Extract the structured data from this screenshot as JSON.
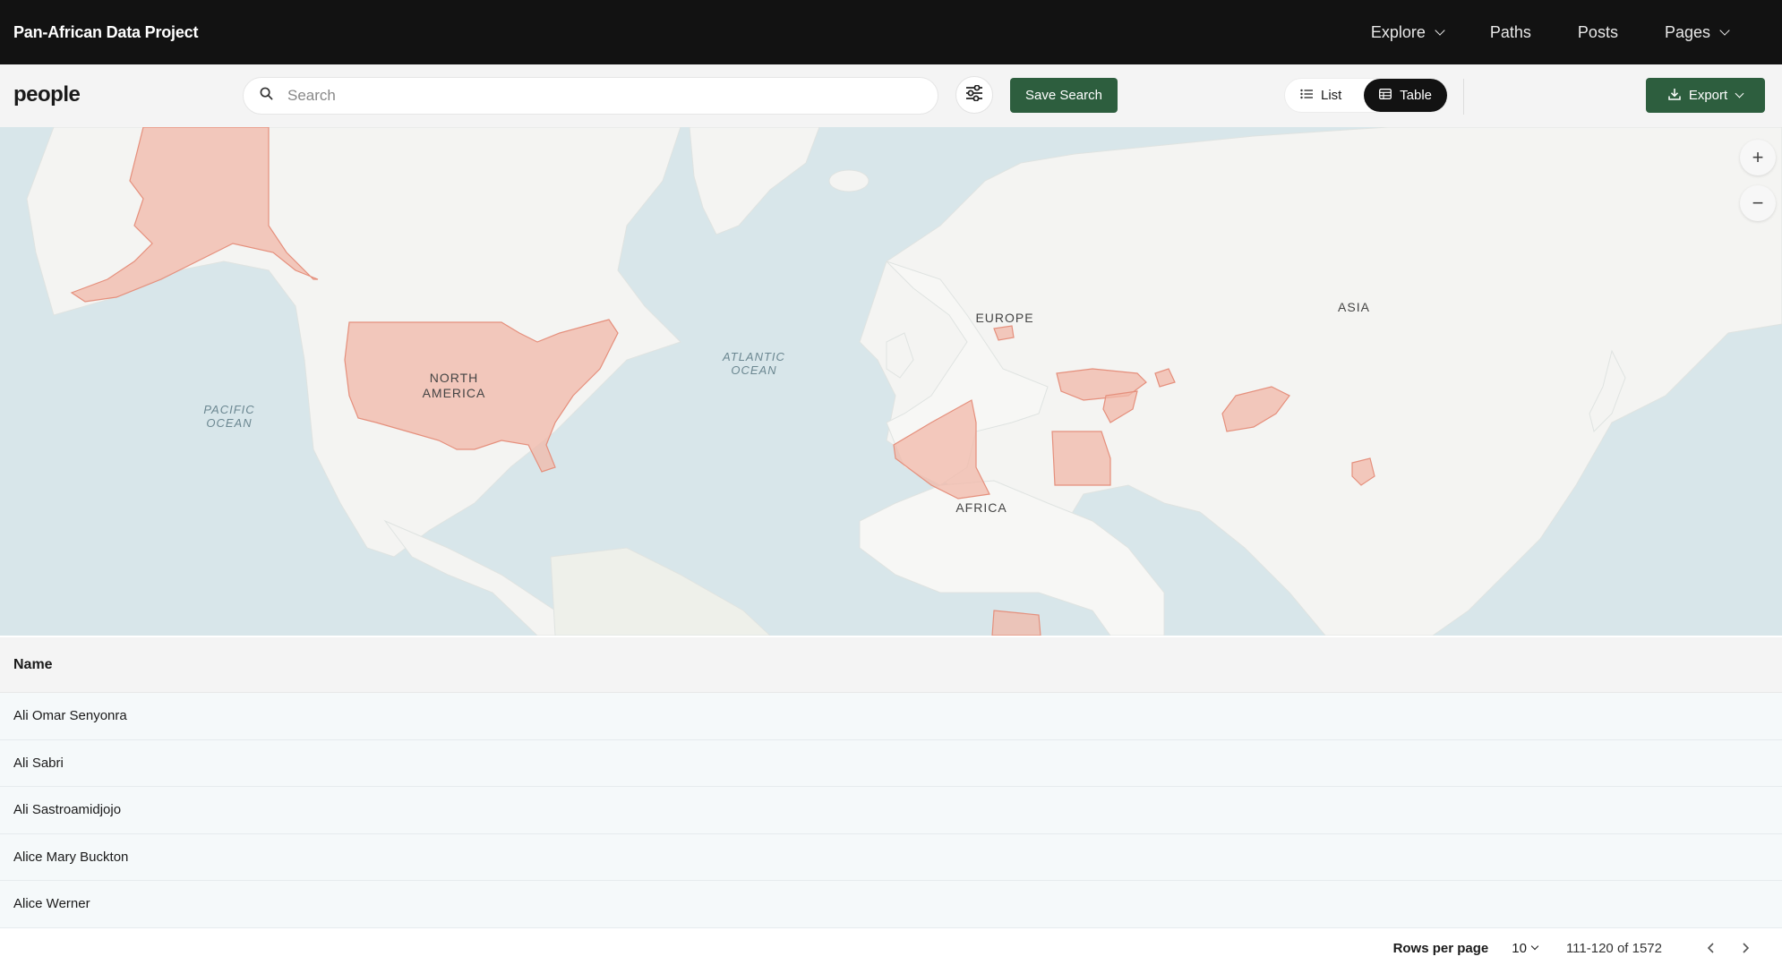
{
  "brand": "Pan-African Data Project",
  "nav": {
    "explore": "Explore",
    "paths": "Paths",
    "posts": "Posts",
    "pages": "Pages"
  },
  "toolbar": {
    "title": "people",
    "search_placeholder": "Search",
    "save_search": "Save Search",
    "view_list": "List",
    "view_table": "Table",
    "active_view": "Table",
    "export": "Export"
  },
  "map": {
    "labels": {
      "north_america": [
        "NORTH",
        "AMERICA"
      ],
      "europe": "EUROPE",
      "asia": "ASIA",
      "africa": "AFRICA",
      "atlantic": [
        "ATLANTIC",
        "OCEAN"
      ],
      "pacific": [
        "PACIFIC",
        "OCEAN"
      ]
    },
    "zoom_in": "+",
    "zoom_out": "−",
    "colors": {
      "water": "#d8e6ea",
      "land": "#f4f4f2",
      "highlight": "#f2b8a8",
      "highlight_stroke": "#e58f7c"
    }
  },
  "table": {
    "column": "Name",
    "rows": [
      "Ali Omar Senyonra",
      "Ali Sabri",
      "Ali Sastroamidjojo",
      "Alice Mary Buckton",
      "Alice Werner"
    ]
  },
  "pagination": {
    "rows_per_page_label": "Rows per page",
    "rows_per_page": "10",
    "range": "111-120 of 1572"
  },
  "colors": {
    "nav_bg": "#121212",
    "accent_green": "#2d5e3e",
    "toolbar_bg": "#f4f4f4"
  }
}
